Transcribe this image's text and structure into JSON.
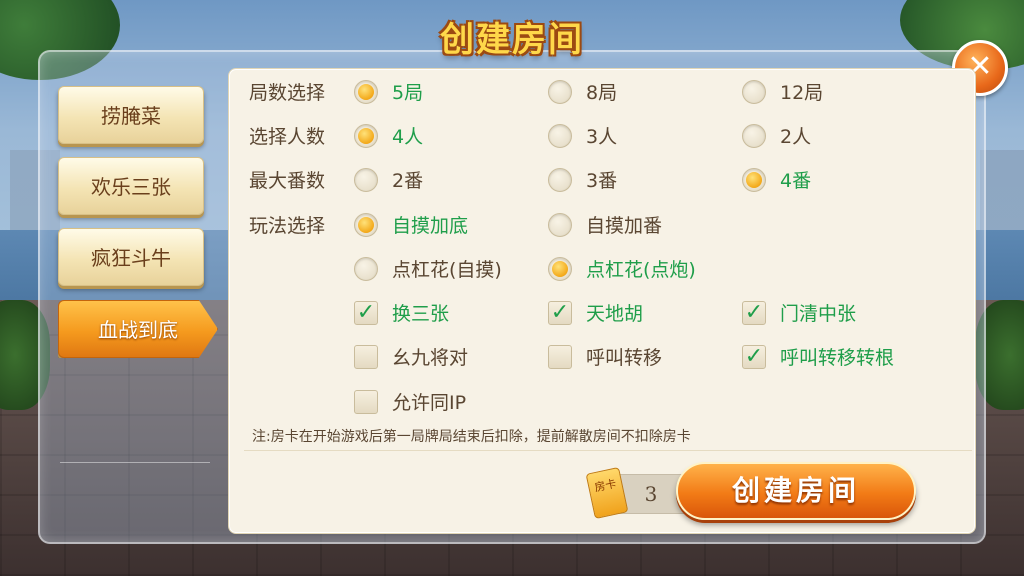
{
  "title": "创建房间",
  "close_icon": "close-x-icon",
  "tabs": [
    {
      "label": "捞腌菜",
      "active": false
    },
    {
      "label": "欢乐三张",
      "active": false
    },
    {
      "label": "疯狂斗牛",
      "active": false
    },
    {
      "label": "血战到底",
      "active": true
    }
  ],
  "rows": {
    "rounds": {
      "label": "局数选择",
      "options": [
        {
          "label": "5局",
          "selected": true
        },
        {
          "label": "8局",
          "selected": false
        },
        {
          "label": "12局",
          "selected": false
        }
      ]
    },
    "players": {
      "label": "选择人数",
      "options": [
        {
          "label": "4人",
          "selected": true
        },
        {
          "label": "3人",
          "selected": false
        },
        {
          "label": "2人",
          "selected": false
        }
      ]
    },
    "max_fan": {
      "label": "最大番数",
      "options": [
        {
          "label": "2番",
          "selected": false
        },
        {
          "label": "3番",
          "selected": false
        },
        {
          "label": "4番",
          "selected": true
        }
      ]
    },
    "play_style": {
      "label": "玩法选择",
      "radios": [
        {
          "label": "自摸加底",
          "selected": true
        },
        {
          "label": "自摸加番",
          "selected": false
        },
        {
          "label": "点杠花(自摸)",
          "selected": false
        },
        {
          "label": "点杠花(点炮)",
          "selected": true
        }
      ],
      "checks": [
        {
          "label": "换三张",
          "checked": true
        },
        {
          "label": "天地胡",
          "checked": true
        },
        {
          "label": "门清中张",
          "checked": true
        },
        {
          "label": "幺九将对",
          "checked": false
        },
        {
          "label": "呼叫转移",
          "checked": false
        },
        {
          "label": "呼叫转移转根",
          "checked": true
        },
        {
          "label": "允许同IP",
          "checked": false
        }
      ]
    }
  },
  "note": "注:房卡在开始游戏后第一局牌局结束后扣除，提前解散房间不扣除房卡",
  "room_card": {
    "icon_label": "房卡",
    "count": "3"
  },
  "create_button": "创建房间",
  "colors": {
    "selected_text": "#1f9e4a",
    "accent_orange": "#f27b16",
    "card_bg": "#f7f2e6"
  }
}
